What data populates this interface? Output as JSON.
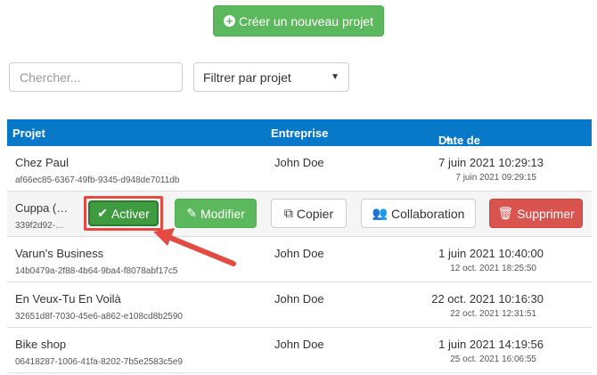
{
  "toolbar": {
    "new_project_label": "Créer un nouveau projet"
  },
  "search": {
    "placeholder": "Chercher..."
  },
  "filter": {
    "selected": "Filtrer par projet"
  },
  "table": {
    "headers": {
      "project": "Projet",
      "company": "Entreprise",
      "date": "Date de création"
    },
    "rows": [
      {
        "name": "Chez Paul",
        "uuid": "af66ec85-6367-49fb-9345-d948de7011db",
        "company": "John Doe",
        "date": "7 juin 2021 10:29:13",
        "date_small": "7 juin 2021 09:29:15"
      },
      {
        "name": "Cuppa (…",
        "uuid": "339f2d92-…"
      },
      {
        "name": "Varun's Business",
        "uuid": "14b0479a-2f88-4b64-9ba4-f8078abf17c5",
        "company": "John Doe",
        "date": "1 juin 2021 10:40:00",
        "date_small": "12 oct. 2021 18:25:50"
      },
      {
        "name": "En Veux-Tu En Voilà",
        "uuid": "32651d8f-7030-45e6-a862-e108cd8b2590",
        "company": "John Doe",
        "date": "22 oct. 2021 10:16:30",
        "date_small": "22 oct. 2021 12:31:51"
      },
      {
        "name": "Bike shop",
        "uuid": "06418287-1006-41fa-8202-7b5e2583c5e9",
        "company": "John Doe",
        "date": "1 juin 2021 14:19:56",
        "date_small": "25 oct. 2021 16:06:55"
      }
    ]
  },
  "actions": {
    "activer": "Activer",
    "modifier": "Modifier",
    "copier": "Copier",
    "collaboration": "Collaboration",
    "supprimer": "Supprimer"
  },
  "colors": {
    "primary": "#0878c8",
    "success": "#5cb85c",
    "danger": "#d9534f",
    "highlight": "#e24a42"
  }
}
